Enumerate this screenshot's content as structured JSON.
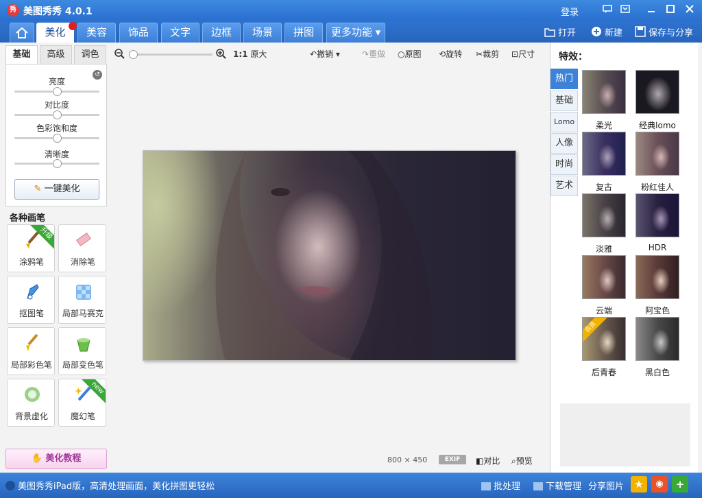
{
  "app": {
    "title": "美图秀秀 4.0.1",
    "icon_text": "秀",
    "login": "登录"
  },
  "nav": {
    "tabs": [
      "美化",
      "美容",
      "饰品",
      "文字",
      "边框",
      "场景",
      "拼图",
      "更多功能"
    ],
    "actions": {
      "open": "打开",
      "new": "新建",
      "save": "保存与分享"
    }
  },
  "left": {
    "subtabs": [
      "基础",
      "高级",
      "调色"
    ],
    "sliders": [
      {
        "label": "亮度",
        "value": 0.5
      },
      {
        "label": "对比度",
        "value": 0.5
      },
      {
        "label": "色彩饱和度",
        "value": 0.5
      },
      {
        "label": "清晰度",
        "value": 0.5
      }
    ],
    "one_key": "一键美化",
    "brushes_title": "各种画笔",
    "brushes": [
      {
        "label": "涂鸦笔",
        "ribbon": "升级"
      },
      {
        "label": "消除笔"
      },
      {
        "label": "抠图笔"
      },
      {
        "label": "局部马赛克"
      },
      {
        "label": "局部彩色笔"
      },
      {
        "label": "局部变色笔"
      },
      {
        "label": "背景虚化"
      },
      {
        "label": "魔幻笔",
        "ribbon": "new"
      }
    ],
    "tutorial": "美化教程"
  },
  "toolbar": {
    "ratio": "1:1",
    "original_size": "原大",
    "undo": "撤销",
    "redo": "重做",
    "original": "原图",
    "rotate": "旋转",
    "crop": "裁剪",
    "size": "尺寸"
  },
  "image_info": {
    "width": "800",
    "times": "×",
    "height": "450",
    "exif": "EXIF",
    "compare": "对比",
    "preview": "预览"
  },
  "effects": {
    "title": "特效：",
    "tabs": [
      "热门",
      "基础",
      "Lomo",
      "人像",
      "时尚",
      "艺术"
    ],
    "items": [
      "柔光",
      "经典lomo",
      "复古",
      "粉红佳人",
      "淡雅",
      "HDR",
      "云端",
      "阿宝色",
      "后青春",
      "黑白色"
    ],
    "ribbon": "会员"
  },
  "status": {
    "promo": "美图秀秀iPad版，高清处理画面，美化拼图更轻松",
    "batch": "批处理",
    "download": "下载管理",
    "share": "分享图片"
  }
}
